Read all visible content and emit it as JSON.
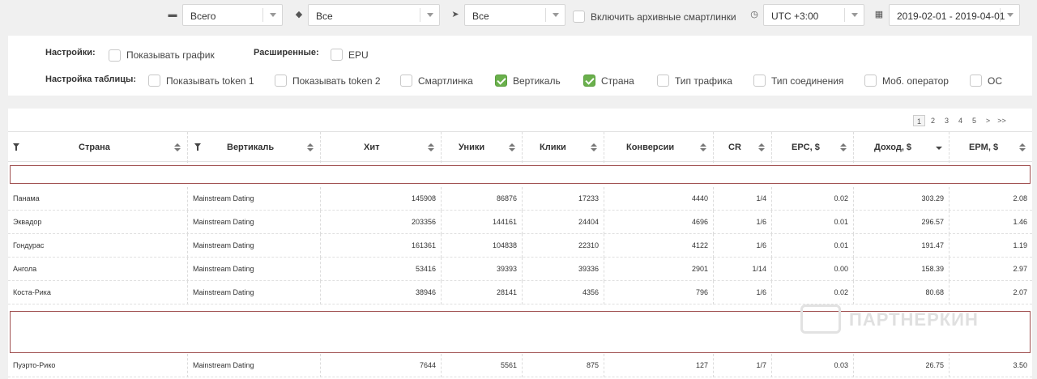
{
  "filters": {
    "source": {
      "icon": "folder-icon",
      "value": "Всего"
    },
    "tags": {
      "icon": "tags-icon",
      "value": "Все"
    },
    "links": {
      "icon": "send-icon",
      "value": "Все"
    },
    "archive_label": "Включить архивные смартлинки",
    "archive_checked": false,
    "timezone": {
      "icon": "clock-icon",
      "value": "UTC +3:00"
    },
    "daterange": {
      "icon": "calendar-icon",
      "value": "2019-02-01 - 2019-04-01"
    }
  },
  "settings": {
    "title": "Настройки:",
    "show_chart": {
      "label": "Показывать график",
      "checked": false
    },
    "advanced_title": "Расширенные:",
    "epu": {
      "label": "EPU",
      "checked": false
    },
    "table_title": "Настройка таблицы:",
    "columns": [
      {
        "label": "Показывать token 1",
        "checked": false
      },
      {
        "label": "Показывать token 2",
        "checked": false
      },
      {
        "label": "Смартлинка",
        "checked": false
      },
      {
        "label": "Вертикаль",
        "checked": true
      },
      {
        "label": "Страна",
        "checked": true
      },
      {
        "label": "Тип трафика",
        "checked": false
      },
      {
        "label": "Тип соединения",
        "checked": false
      },
      {
        "label": "Моб. оператор",
        "checked": false
      },
      {
        "label": "ОС",
        "checked": false
      }
    ]
  },
  "pager": [
    "1",
    "2",
    "3",
    "4",
    "5",
    ">",
    ">>"
  ],
  "pager_active": "1",
  "table": {
    "headers": [
      "Страна",
      "Вертикаль",
      "Хит",
      "Уники",
      "Клики",
      "Конверсии",
      "CR",
      "EPC, $",
      "Доход, $",
      "EPM, $"
    ],
    "rows": [
      [
        "Панама",
        "Mainstream Dating",
        "145908",
        "86876",
        "17233",
        "4440",
        "1/4",
        "0.02",
        "303.29",
        "2.08"
      ],
      [
        "Эквадор",
        "Mainstream Dating",
        "203356",
        "144161",
        "24404",
        "4696",
        "1/6",
        "0.01",
        "296.57",
        "1.46"
      ],
      [
        "Гондурас",
        "Mainstream Dating",
        "161361",
        "104838",
        "22310",
        "4122",
        "1/6",
        "0.01",
        "191.47",
        "1.19"
      ],
      [
        "Ангола",
        "Mainstream Dating",
        "53416",
        "39393",
        "39336",
        "2901",
        "1/14",
        "0.00",
        "158.39",
        "2.97"
      ],
      [
        "Коста-Рика",
        "Mainstream Dating",
        "38946",
        "28141",
        "4356",
        "796",
        "1/6",
        "0.02",
        "80.68",
        "2.07"
      ],
      [
        "Пуэрто-Рико",
        "Mainstream Dating",
        "7644",
        "5561",
        "875",
        "127",
        "1/7",
        "0.03",
        "26.75",
        "3.50"
      ]
    ]
  },
  "watermark": "ПАРТНЕРКИН"
}
